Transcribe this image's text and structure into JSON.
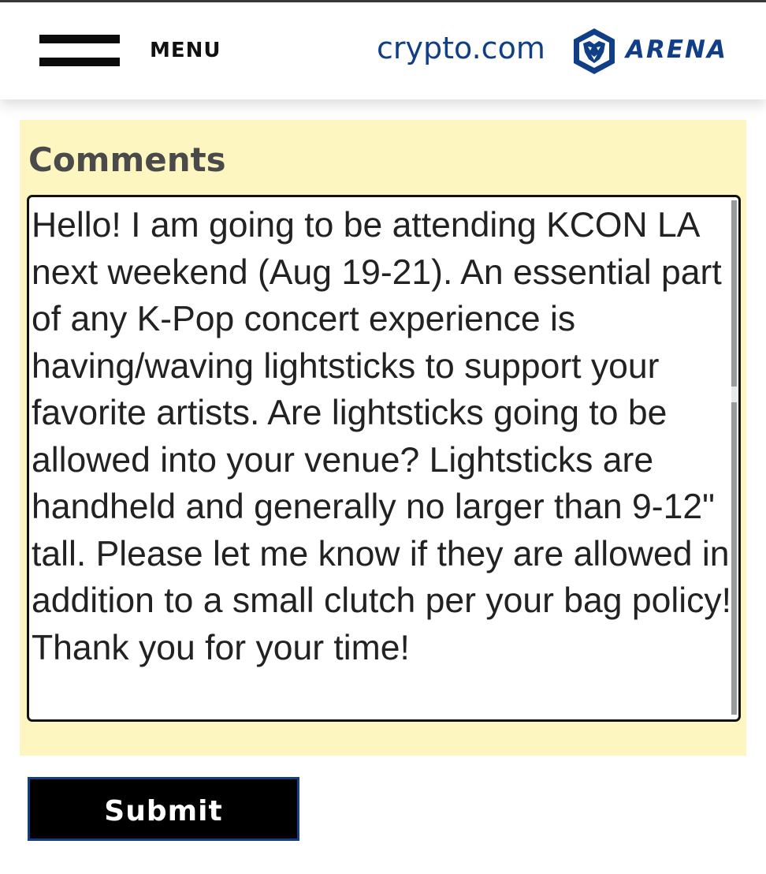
{
  "header": {
    "menu_label": "MENU",
    "menu_icon": "hamburger-menu-icon",
    "brand": {
      "name_part1": "crypto.com",
      "logo_icon": "crypto-lion-shield-icon",
      "name_part2": "ARENA"
    }
  },
  "form": {
    "comments_label": "Comments",
    "comments_value": "Hello! I am going to be attending KCON LA next weekend (Aug 19-21). An essential part of any K-Pop concert experience is having/waving lightsticks to support your favorite artists. Are lightsticks going to be allowed into your venue? Lightsticks are handheld and generally no larger than 9-12\" tall. Please let me know if they are allowed in addition to a small clutch per your bag policy! Thank you for your time!",
    "submit_label": "Submit"
  },
  "colors": {
    "brand_blue": "#103f87",
    "form_background": "#fdf6c0",
    "button_background": "#000000"
  }
}
